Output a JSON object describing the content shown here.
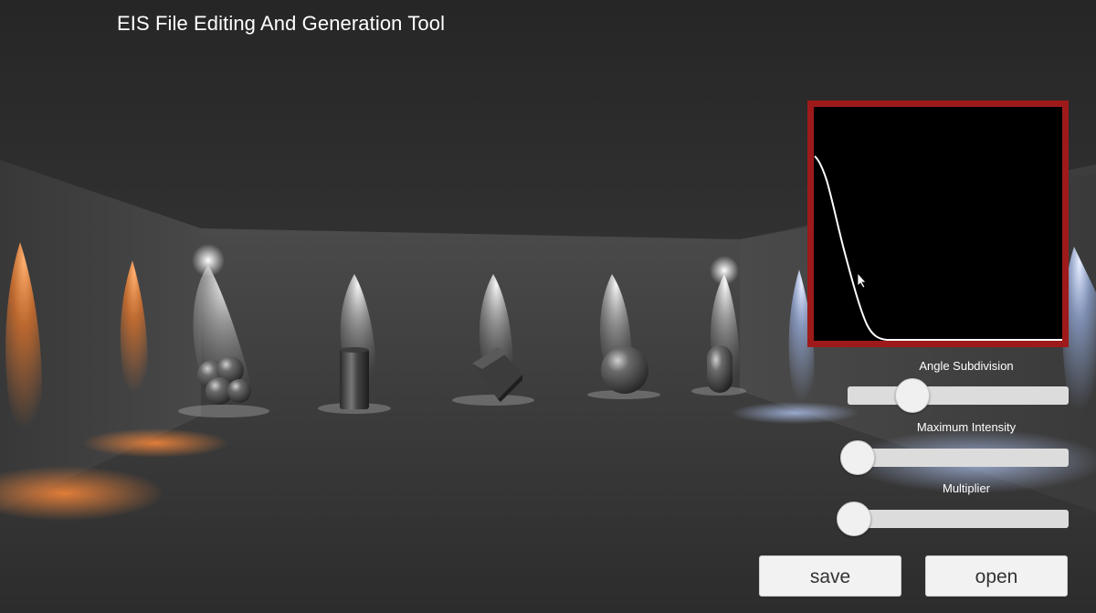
{
  "app": {
    "title": "EIS File Editing And Generation Tool"
  },
  "curve_panel": {
    "border_color": "#9e1a1a",
    "background": "#000000",
    "curve_color": "#ffffff",
    "cursor_icon": "mouse-pointer-icon"
  },
  "sliders": [
    {
      "label": "Angle Subdivision",
      "value": 0.3
    },
    {
      "label": "Maximum Intensity",
      "value": 0.0
    },
    {
      "label": "Multiplier",
      "value": 0.0
    }
  ],
  "buttons": {
    "save_label": "save",
    "open_label": "open"
  },
  "colors": {
    "warm_light": "#f07a2a",
    "cool_light": "#a9c4ff",
    "room": "#3a3a3a"
  }
}
